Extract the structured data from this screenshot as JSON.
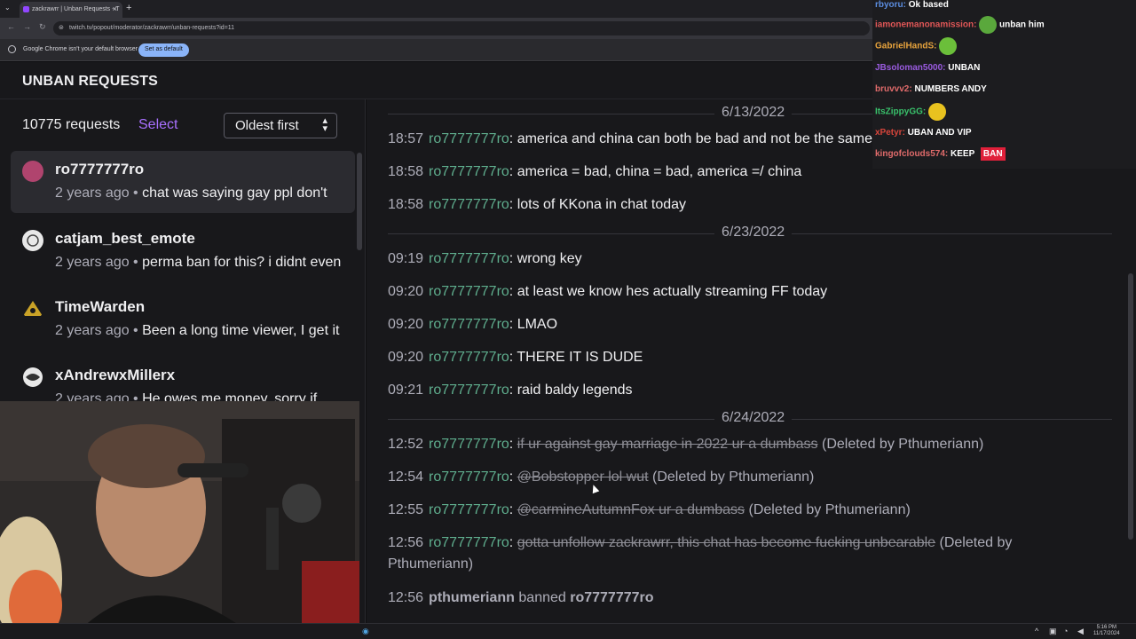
{
  "browser": {
    "tab_title": "zackrawrr | Unban Requests - T",
    "tab_close": "×",
    "new_tab": "+",
    "tab_menu": "⌄",
    "url": "twitch.tv/popout/moderator/zackrawrr/unban-requests?id=11",
    "infobar_text": "Google Chrome isn't your default browser",
    "infobar_button": "Set as default"
  },
  "header": {
    "title": "UNBAN REQUESTS"
  },
  "left": {
    "count": "10775 requests",
    "select_label": "Select",
    "sort_label": "Oldest first",
    "requests": [
      {
        "user": "ro7777777ro",
        "ago": "2 years ago",
        "sep": " • ",
        "preview": "chat was saying gay ppl don't",
        "avatar_color": "#b0446e"
      },
      {
        "user": "catjam_best_emote",
        "ago": "2 years ago",
        "sep": " • ",
        "preview": "perma ban for this? i didnt even",
        "avatar_color": "#e8e8e8"
      },
      {
        "user": "TimeWarden",
        "ago": "2 years ago",
        "sep": " • ",
        "preview": "Been a long time viewer, I get it",
        "avatar_color": "#c9a227"
      },
      {
        "user": "xAndrewxMillerx",
        "ago": "2 years ago",
        "sep": " • ",
        "preview": "He owes me money, sorry if",
        "avatar_color": "#e8e8e8"
      }
    ]
  },
  "log": {
    "dates": [
      "6/13/2022",
      "6/23/2022",
      "6/24/2022"
    ],
    "messages": [
      {
        "time": "18:57",
        "user": "ro7777777ro",
        "text": "america and china can both be bad and not be the same"
      },
      {
        "time": "18:58",
        "user": "ro7777777ro",
        "text": "america = bad, china = bad, america =/ china"
      },
      {
        "time": "18:58",
        "user": "ro7777777ro",
        "text": "lots of KKona in chat today"
      },
      {
        "time": "09:19",
        "user": "ro7777777ro",
        "text": "wrong key"
      },
      {
        "time": "09:20",
        "user": "ro7777777ro",
        "text": "at least we know hes actually streaming FF today"
      },
      {
        "time": "09:20",
        "user": "ro7777777ro",
        "text": "LMAO"
      },
      {
        "time": "09:20",
        "user": "ro7777777ro",
        "text": "THERE IT IS DUDE"
      },
      {
        "time": "09:21",
        "user": "ro7777777ro",
        "text": "raid baldy legends"
      },
      {
        "time": "12:52",
        "user": "ro7777777ro",
        "text": "if ur against gay marriage in 2022 ur a dumbass",
        "deleted_by": "(Deleted by Pthumeriann)"
      },
      {
        "time": "12:54",
        "user": "ro7777777ro",
        "text": "@Bobstopper lol wut",
        "deleted_by": "(Deleted by Pthumeriann)"
      },
      {
        "time": "12:55",
        "user": "ro7777777ro",
        "text": "@carmineAutumnFox ur a dumbass",
        "deleted_by": "(Deleted by Pthumeriann)"
      },
      {
        "time": "12:56",
        "user": "ro7777777ro",
        "text": "gotta unfollow zackrawrr, this chat has become fucking unbearable",
        "deleted_by": "(Deleted by Pthumeriann)"
      },
      {
        "time": "12:56",
        "moderator": "pthumeriann",
        "action": "banned",
        "target": "ro7777777ro"
      }
    ]
  },
  "chat_overlay": [
    {
      "user": "rbyoru:",
      "text": " Ok based",
      "color": "#5b8de0"
    },
    {
      "user": "iamonemanonamission:",
      "text": " unban him",
      "color": "#e05656"
    },
    {
      "user": "GabrielHandS:",
      "text": "",
      "color": "#e6a23c"
    },
    {
      "user": "JBsoloman5000:",
      "text": " UNBAN",
      "color": "#9a5be0"
    },
    {
      "user": "bruvvv2:",
      "text": " NUMBERS ANDY",
      "color": "#e06b6b"
    },
    {
      "user": "ItsZippyGG:",
      "text": "",
      "color": "#39c16b"
    },
    {
      "user": "xPetyr:",
      "text": " UBAN AND VIP",
      "color": "#d8453b"
    },
    {
      "user": "kingofclouds574:",
      "text": " KEEP",
      "color": "#e06b6b"
    }
  ],
  "chat_ban_badge": "BAN",
  "taskbar": {
    "time": "5:16 PM",
    "date": "11/17/2024"
  },
  "colors": {
    "accent": "#a970ff",
    "username": "#5fae8e",
    "background": "#18181b"
  }
}
